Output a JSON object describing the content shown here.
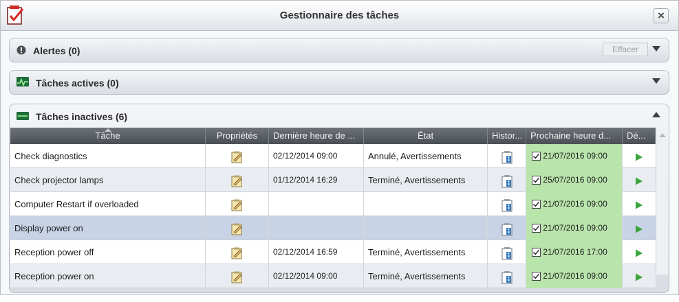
{
  "window": {
    "title": "Gestionnaire des tâches",
    "close_label": "×"
  },
  "alerts": {
    "title": "Alertes (0)",
    "clear_label": "Effacer"
  },
  "active": {
    "title": "Tâches actives (0)"
  },
  "inactive": {
    "title": "Tâches inactives (6)",
    "columns": [
      "Tâche",
      "Propriétés",
      "Dernière heure de ...",
      "État",
      "Histor...",
      "Prochaine heure d...",
      "Dé..."
    ],
    "rows": [
      {
        "task": "Check diagnostics",
        "last_run": "02/12/2014 09:00",
        "state": "Annulé, Avertissements",
        "next_run": "21/07/2016 09:00"
      },
      {
        "task": "Check projector lamps",
        "last_run": "01/12/2014 16:29",
        "state": "Terminé, Avertissements",
        "next_run": "25/07/2016 09:00"
      },
      {
        "task": "Computer Restart if overloaded",
        "last_run": "",
        "state": "",
        "next_run": "21/07/2016 09:00"
      },
      {
        "task": "Display power on",
        "last_run": "",
        "state": "",
        "next_run": "21/07/2016 09:00"
      },
      {
        "task": "Reception power off",
        "last_run": "02/12/2014 16:59",
        "state": "Terminé, Avertissements",
        "next_run": "21/07/2016 17:00"
      },
      {
        "task": "Reception power on",
        "last_run": "02/12/2014 09:00",
        "state": "Terminé, Avertissements",
        "next_run": "21/07/2016 09:00"
      }
    ]
  },
  "colors": {
    "next_run_bg": "#b9e4ac",
    "play": "#3aa53a",
    "header_bg": "#5b6066",
    "selected_row": "#c9d3e6"
  },
  "icons": [
    "task-manager-icon",
    "alert-icon",
    "active-tasks-icon",
    "inactive-tasks-icon",
    "properties-icon",
    "history-icon",
    "checkbox-icon",
    "play-icon"
  ]
}
